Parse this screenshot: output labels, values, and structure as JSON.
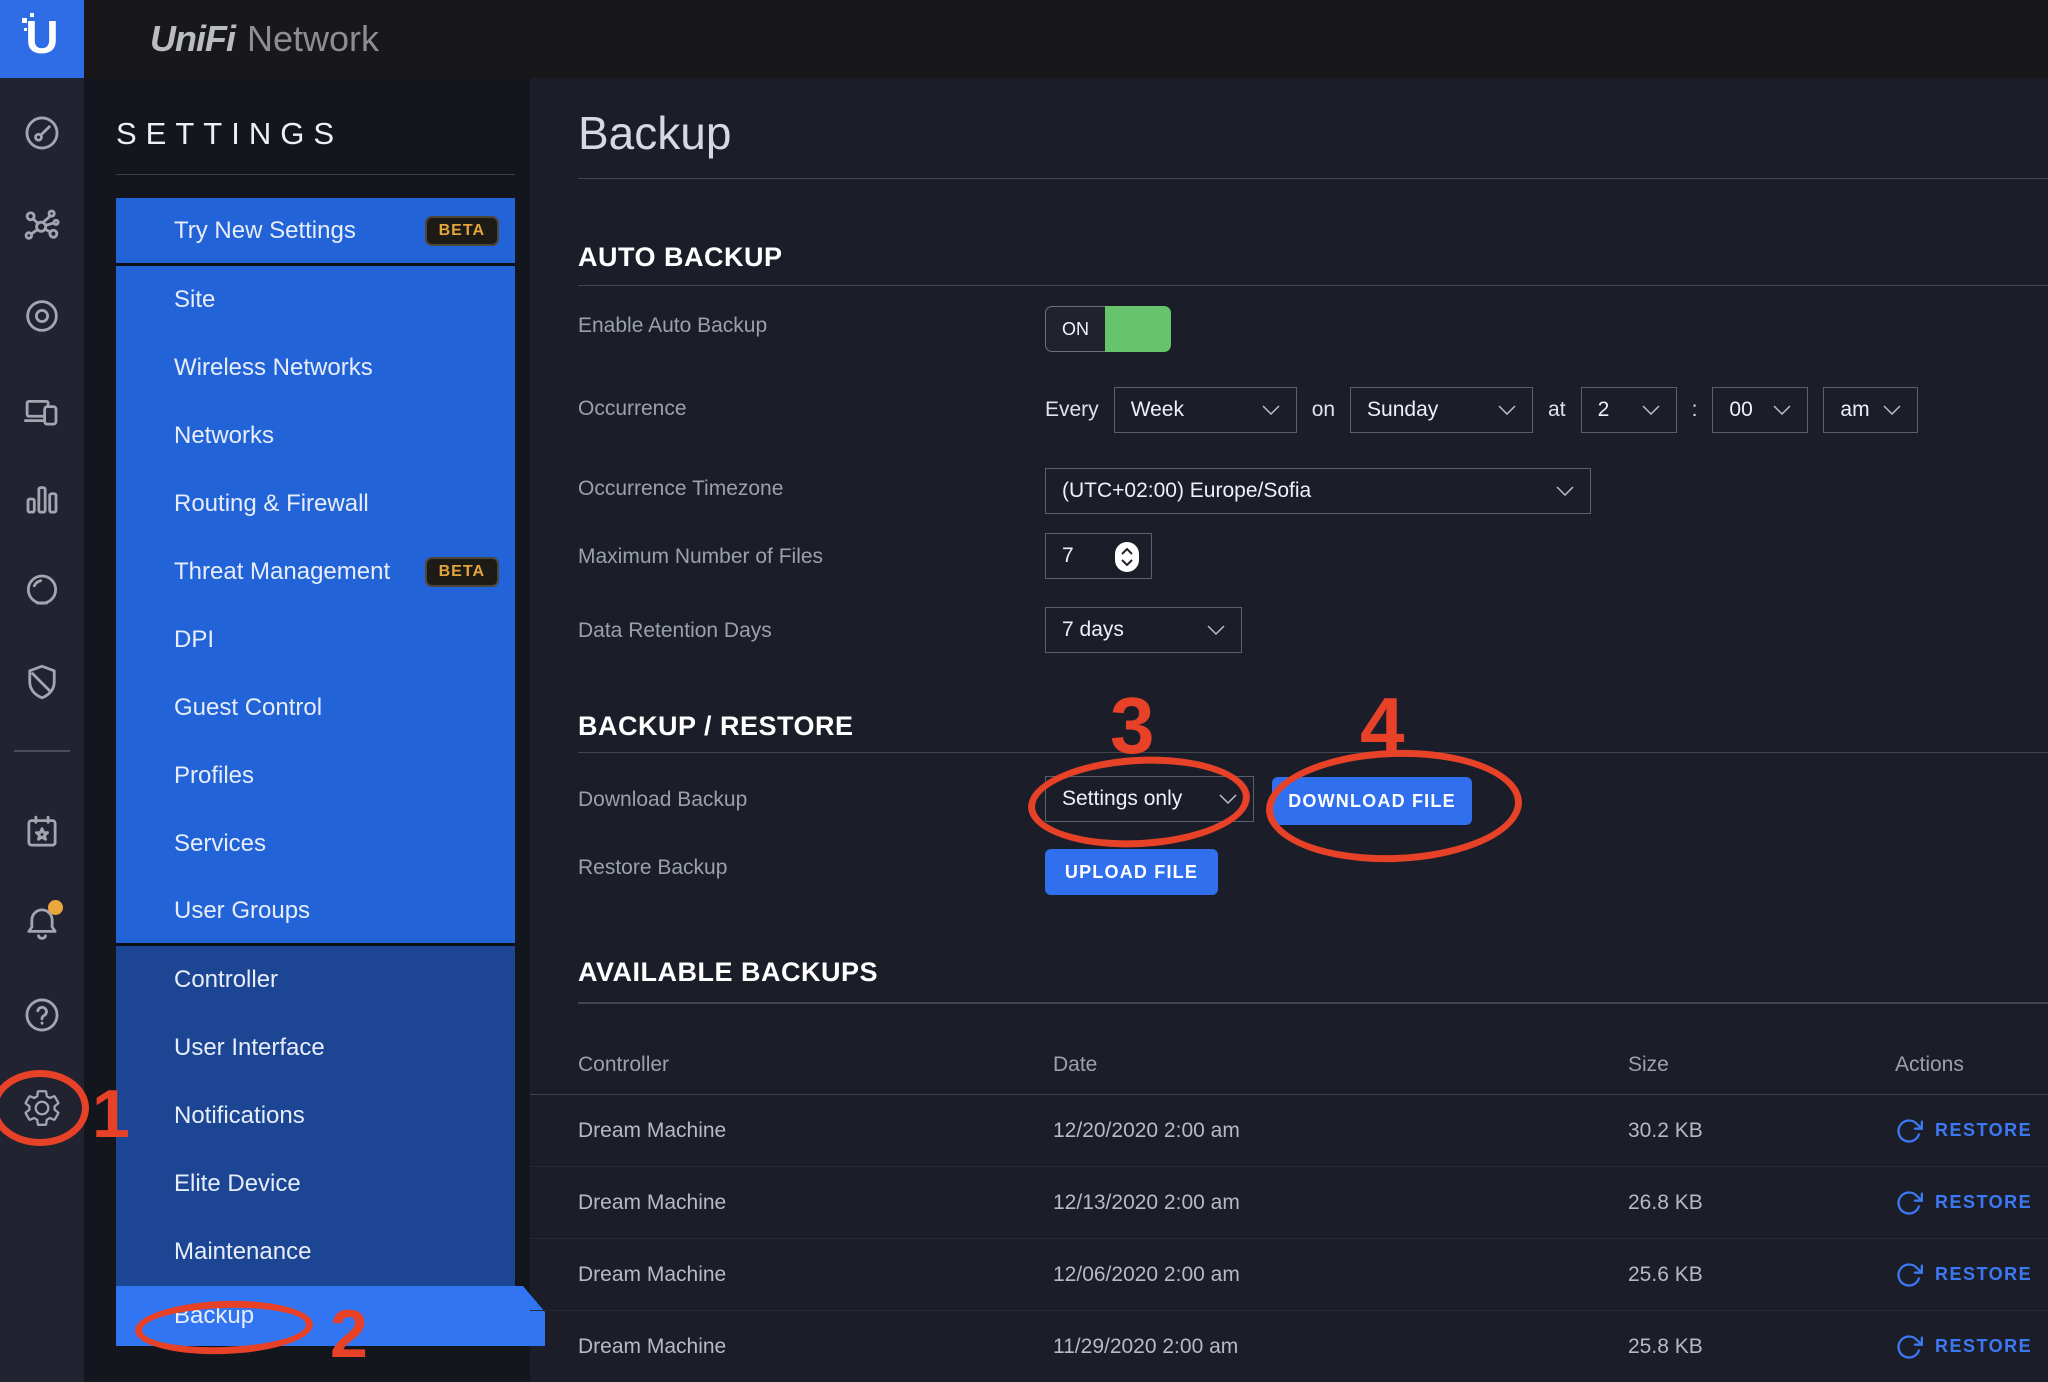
{
  "topbar": {
    "logo_letter": "U",
    "brand_primary": "UniFi",
    "brand_secondary": "Network"
  },
  "rail": {
    "icons": [
      "dashboard-gauge",
      "topology",
      "devices",
      "clients",
      "statistics",
      "insights-bubble",
      "security-shield",
      "events-calendar",
      "alerts-bell",
      "help",
      "settings-gear"
    ]
  },
  "sidebar": {
    "heading": "SETTINGS",
    "beta_label": "BETA",
    "items": [
      {
        "label": "Try New Settings",
        "beta": true,
        "cls": "up divider-after"
      },
      {
        "label": "Site",
        "cls": "up"
      },
      {
        "label": "Wireless Networks",
        "cls": "up"
      },
      {
        "label": "Networks",
        "cls": "up"
      },
      {
        "label": "Routing & Firewall",
        "cls": "up"
      },
      {
        "label": "Threat Management",
        "beta": true,
        "cls": "up"
      },
      {
        "label": "DPI",
        "cls": "up"
      },
      {
        "label": "Guest Control",
        "cls": "up"
      },
      {
        "label": "Profiles",
        "cls": "up"
      },
      {
        "label": "Services",
        "cls": "up"
      },
      {
        "label": "User Groups",
        "cls": "up divider-after"
      },
      {
        "label": "Controller",
        "cls": "low"
      },
      {
        "label": "User Interface",
        "cls": "low"
      },
      {
        "label": "Notifications",
        "cls": "low"
      },
      {
        "label": "Elite Device",
        "cls": "low"
      },
      {
        "label": "Maintenance",
        "cls": "low"
      },
      {
        "label": "Backup",
        "cls": "active"
      }
    ]
  },
  "page": {
    "title": "Backup",
    "auto_backup": {
      "heading": "AUTO BACKUP",
      "enable_label": "Enable Auto Backup",
      "toggle_state": "ON",
      "occurrence_label": "Occurrence",
      "every_word": "Every",
      "period_value": "Week",
      "on_word": "on",
      "day_value": "Sunday",
      "at_word": "at",
      "hour_value": "2",
      "colon": ":",
      "minute_value": "00",
      "ampm_value": "am",
      "timezone_label": "Occurrence Timezone",
      "timezone_value": "(UTC+02:00) Europe/Sofia",
      "max_files_label": "Maximum Number of Files",
      "max_files_value": "7",
      "retention_label": "Data Retention Days",
      "retention_value": "7 days"
    },
    "backup_restore": {
      "heading": "BACKUP / RESTORE",
      "download_label": "Download Backup",
      "download_option": "Settings only",
      "download_button": "DOWNLOAD FILE",
      "restore_label": "Restore Backup",
      "upload_button": "UPLOAD FILE"
    },
    "available_backups": {
      "heading": "AVAILABLE BACKUPS",
      "columns": {
        "controller": "Controller",
        "date": "Date",
        "size": "Size",
        "actions": "Actions"
      },
      "rows": [
        {
          "controller": "Dream Machine",
          "date": "12/20/2020 2:00 am",
          "size": "30.2 KB",
          "action": "RESTORE"
        },
        {
          "controller": "Dream Machine",
          "date": "12/13/2020 2:00 am",
          "size": "26.8 KB",
          "action": "RESTORE"
        },
        {
          "controller": "Dream Machine",
          "date": "12/06/2020 2:00 am",
          "size": "25.6 KB",
          "action": "RESTORE"
        },
        {
          "controller": "Dream Machine",
          "date": "11/29/2020 2:00 am",
          "size": "25.8 KB",
          "action": "RESTORE"
        }
      ]
    }
  },
  "annotations": {
    "step1": "1",
    "step2": "2",
    "step3": "3",
    "step4": "4"
  },
  "colors": {
    "annotation_red": "#e74128",
    "accent_blue": "#3070ee",
    "menu_blue": "#2263d8",
    "menu_blue_dark": "#1c4694",
    "menu_blue_active": "#3175f2",
    "toggle_green": "#67c36c",
    "beta_gold": "#e3a43d",
    "alert_dot_orange": "#eca63e"
  }
}
